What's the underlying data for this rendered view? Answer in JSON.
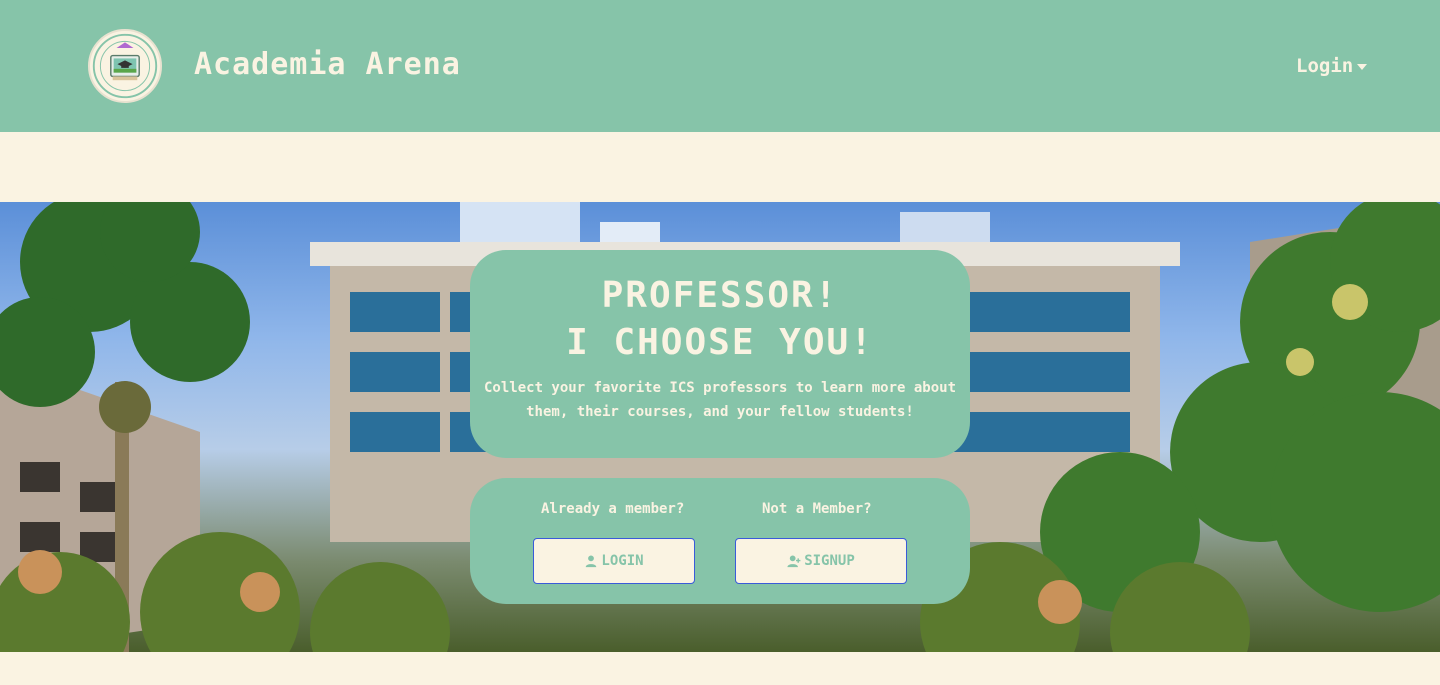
{
  "navbar": {
    "brand": "Academia Arena",
    "logo_text": "ACADEMIA ARENA",
    "login_dropdown": "Login"
  },
  "hero": {
    "title_line1": "PROFESSOR!",
    "title_line2": "I CHOOSE YOU!",
    "subtitle": "Collect your favorite ICS professors to learn more about them, their courses, and your fellow students!"
  },
  "actions": {
    "member_label": "Already a member?",
    "login_button": "LOGIN",
    "not_member_label": "Not a Member?",
    "signup_button": "SIGNUP"
  },
  "colors": {
    "accent": "#86c4a9",
    "cream": "#faf3e2",
    "button_border": "#3a5bd9"
  },
  "icons": {
    "login": "person-icon",
    "signup": "person-add-icon",
    "dropdown": "caret-down-icon"
  }
}
